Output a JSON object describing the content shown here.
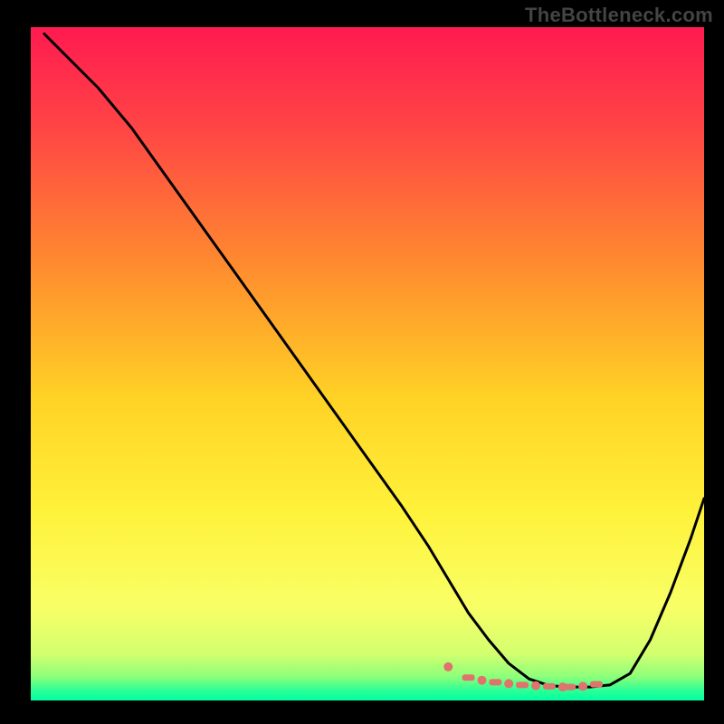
{
  "watermark": "TheBottleneck.com",
  "colors": {
    "frame": "#000000",
    "curve": "#000000",
    "marker": "#e0736c",
    "gradient_stops": [
      {
        "offset": 0.0,
        "color": "#ff1a50"
      },
      {
        "offset": 0.15,
        "color": "#ff4545"
      },
      {
        "offset": 0.35,
        "color": "#ff8a2f"
      },
      {
        "offset": 0.55,
        "color": "#ffd225"
      },
      {
        "offset": 0.72,
        "color": "#fff23a"
      },
      {
        "offset": 0.86,
        "color": "#f8ff66"
      },
      {
        "offset": 0.93,
        "color": "#d4ff6f"
      },
      {
        "offset": 0.965,
        "color": "#8cff7a"
      },
      {
        "offset": 0.985,
        "color": "#2cff96"
      },
      {
        "offset": 1.0,
        "color": "#00ffa2"
      }
    ]
  },
  "chart_data": {
    "type": "line",
    "title": "",
    "xlabel": "",
    "ylabel": "",
    "xlim": [
      0,
      100
    ],
    "ylim": [
      0,
      100
    ],
    "grid": false,
    "legend": false,
    "series": [
      {
        "name": "bottleneck-curve",
        "x": [
          2,
          6,
          10,
          15,
          20,
          25,
          30,
          35,
          40,
          45,
          50,
          55,
          59,
          62,
          65,
          68,
          71,
          74,
          77,
          80,
          83,
          86,
          89,
          92,
          95,
          98,
          100
        ],
        "y": [
          99,
          95,
          91,
          85,
          78,
          71,
          64,
          57,
          50,
          43,
          36,
          29,
          23,
          18,
          13,
          9,
          5.5,
          3.2,
          2.2,
          2.0,
          2.0,
          2.3,
          4.0,
          9,
          16,
          24,
          30
        ]
      }
    ],
    "markers": {
      "name": "flat-region",
      "x": [
        62,
        65,
        67,
        69,
        71,
        73,
        75,
        77,
        79,
        80,
        82,
        84
      ],
      "y": [
        5.0,
        3.4,
        3.0,
        2.7,
        2.5,
        2.3,
        2.2,
        2.1,
        2.0,
        2.0,
        2.1,
        2.4
      ]
    }
  }
}
